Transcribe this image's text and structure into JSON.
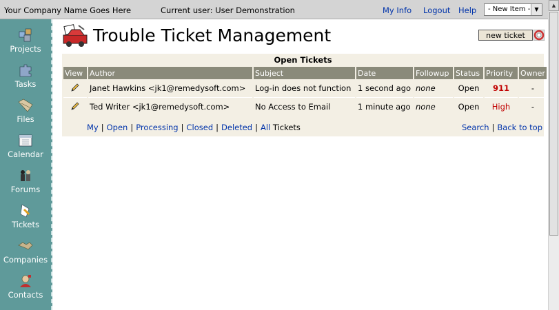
{
  "topbar": {
    "company": "Your Company Name Goes Here",
    "current_user": "Current user: User Demonstration",
    "my_info": "My Info",
    "logout": "Logout",
    "help": "Help",
    "new_item_select": "- New Item -"
  },
  "sidebar": {
    "items": [
      {
        "label": "Projects",
        "icon": "projects-icon"
      },
      {
        "label": "Tasks",
        "icon": "tasks-icon"
      },
      {
        "label": "Files",
        "icon": "files-icon"
      },
      {
        "label": "Calendar",
        "icon": "calendar-icon"
      },
      {
        "label": "Forums",
        "icon": "forums-icon"
      },
      {
        "label": "Tickets",
        "icon": "tickets-icon"
      },
      {
        "label": "Companies",
        "icon": "companies-icon"
      },
      {
        "label": "Contacts",
        "icon": "contacts-icon"
      }
    ]
  },
  "header": {
    "title": "Trouble Ticket Management",
    "new_ticket": "new ticket"
  },
  "tickets": {
    "section_title": "Open Tickets",
    "columns": [
      "View",
      "Author",
      "Subject",
      "Date",
      "Followup",
      "Status",
      "Priority",
      "Owner"
    ],
    "rows": [
      {
        "author": "Janet Hawkins <jk1@remedysoft.com>",
        "subject": "Log-in does not function",
        "date": "1 second ago",
        "followup": "none",
        "status": "Open",
        "priority": "911",
        "owner": "-"
      },
      {
        "author": "Ted Writer <jk1@remedysoft.com>",
        "subject": "No Access to Email",
        "date": "1 minute ago",
        "followup": "none",
        "status": "Open",
        "priority": "High",
        "owner": "-"
      }
    ],
    "filters": {
      "my": "My",
      "open": "Open",
      "processing": "Processing",
      "closed": "Closed",
      "deleted": "Deleted",
      "all": "All",
      "tickets_suffix": "Tickets"
    },
    "search": "Search",
    "back_to_top": "Back to top"
  },
  "colors": {
    "sidebar": "#5f9a9a",
    "panel": "#f3efe4",
    "table_header": "#8a8a7a",
    "link": "#0033aa",
    "priority": "#c00000"
  }
}
